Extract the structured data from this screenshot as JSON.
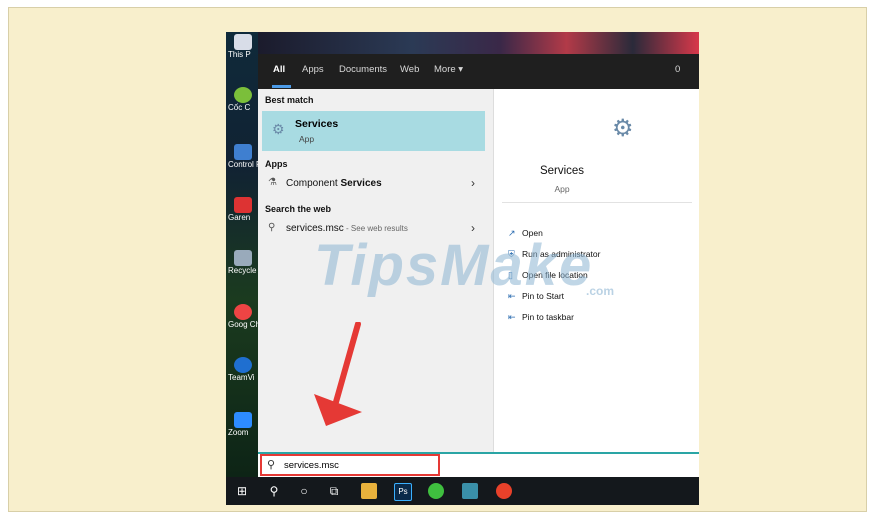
{
  "tabs": [
    "All",
    "Apps",
    "Documents",
    "Web",
    "More ▾"
  ],
  "tabs_right": "0",
  "desktop_icons": [
    "This P",
    "Cốc C",
    "Control P",
    "Garen",
    "Recycle",
    "Goog Chrom",
    "TeamVi",
    "Zoom"
  ],
  "left_pane": {
    "best_match_heading": "Best match",
    "best_title": "Services",
    "best_sub": "App",
    "apps_heading": "Apps",
    "apps_item_prefix": "Component ",
    "apps_item_bold": "Services",
    "web_heading": "Search the web",
    "web_query": "services.msc",
    "web_hint": " - See web results"
  },
  "right_pane": {
    "title": "Services",
    "subtitle": "App",
    "actions": [
      "Open",
      "Run as administrator",
      "Open file location",
      "Pin to Start",
      "Pin to taskbar"
    ]
  },
  "search": {
    "value": "services.msc"
  },
  "watermark": {
    "main": "TipsMake",
    "com": ".com"
  },
  "colors": {
    "highlight": "#a8dbe2",
    "accent": "#4c9be8",
    "annotation": "#e53935"
  }
}
